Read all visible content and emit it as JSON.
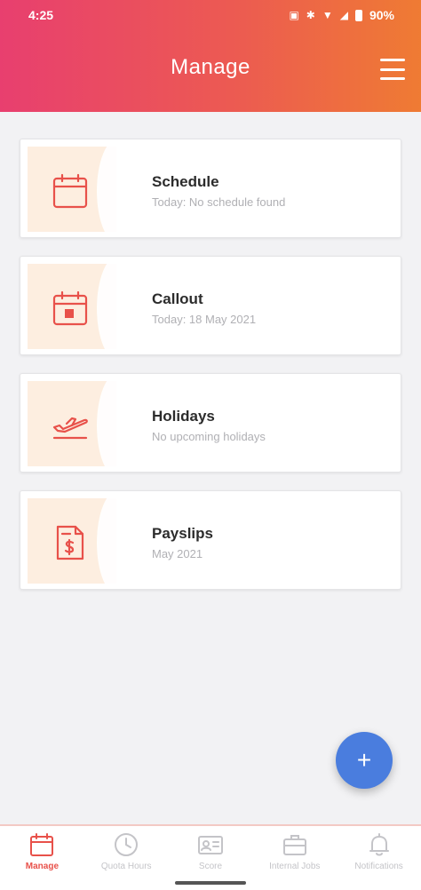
{
  "status_bar": {
    "time": "4:25",
    "battery": "90%"
  },
  "header": {
    "title": "Manage"
  },
  "cards": [
    {
      "title": "Schedule",
      "subtitle": "Today: No schedule found",
      "icon": "calendar-icon"
    },
    {
      "title": "Callout",
      "subtitle": "Today: 18 May 2021",
      "icon": "calendar-callout-icon"
    },
    {
      "title": "Holidays",
      "subtitle": "No upcoming holidays",
      "icon": "plane-icon"
    },
    {
      "title": "Payslips",
      "subtitle": "May 2021",
      "icon": "payslip-icon"
    }
  ],
  "fab": {
    "label": "+"
  },
  "bottom_nav": [
    {
      "label": "Manage",
      "icon": "calendar-icon",
      "active": true
    },
    {
      "label": "Quota Hours",
      "icon": "clock-icon",
      "active": false
    },
    {
      "label": "Score",
      "icon": "id-card-icon",
      "active": false
    },
    {
      "label": "Internal Jobs",
      "icon": "briefcase-icon",
      "active": false
    },
    {
      "label": "Notifications",
      "icon": "bell-icon",
      "active": false
    }
  ],
  "colors": {
    "accent_start": "#e83f6f",
    "accent_end": "#ef7b33",
    "fab": "#4a7dde",
    "icon": "#e8514a",
    "thumb_bg": "#fdeee0"
  }
}
